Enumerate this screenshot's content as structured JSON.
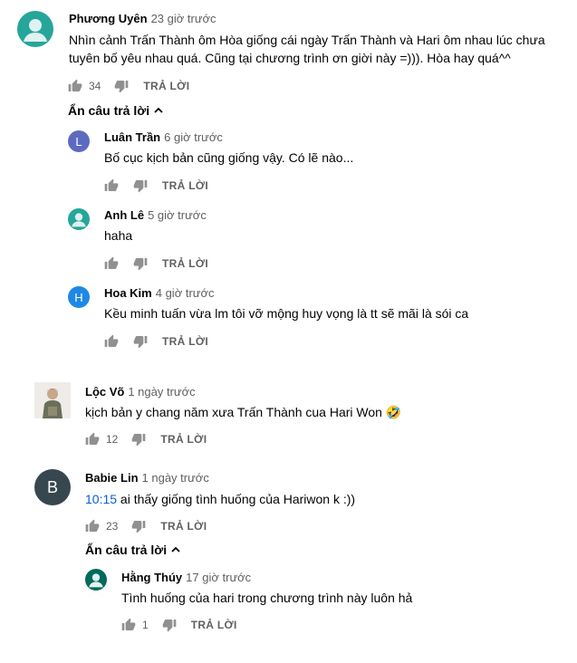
{
  "ui": {
    "reply_label": "TRẢ LỜI",
    "hide_replies_label": "Ẩn câu trả lời"
  },
  "colors": {
    "link": "#065fd4",
    "meta": "#606060",
    "text": "#030303",
    "avatar_teal": "#26a69a",
    "avatar_purple": "#5c6bc0",
    "avatar_blue": "#1e88e5",
    "avatar_slate": "#37474f",
    "avatar_green": "#00695c"
  },
  "comments": [
    {
      "author": "Phương Uyên",
      "time": "23 giờ trước",
      "lines": [
        "Nhìn cảnh Trấn Thành ôm Hòa giống cái ngày Trấn Thành và Hari ôm nhau lúc chưa",
        "tuyên bố yêu nhau quá. Cũng tại chương trình ơn giời này =))). Hòa hay quá^^"
      ],
      "likes": "34",
      "avatar_icon": "default-person-icon",
      "replies": [
        {
          "author": "Luân Trần",
          "time": "6 giờ trước",
          "text": "Bố cục kịch bản cũng giống vậy. Có lẽ nào...",
          "initial": "L"
        },
        {
          "author": "Anh Lê",
          "time": "5 giờ trước",
          "text": "haha",
          "avatar_icon": "default-person-icon"
        },
        {
          "author": "Hoa Kim",
          "time": "4 giờ trước",
          "text": "Kều minh tuấn vừa lm tôi vỡ mộng huy vọng là tt sẽ mãi là sói ca",
          "initial": "H"
        }
      ]
    },
    {
      "author": "Lộc Võ",
      "time": "1 ngày trước",
      "text": "kịch bản y chang năm xưa Trấn Thành cua Hari Won 🤣",
      "likes": "12",
      "avatar_icon": "photo-avatar-icon"
    },
    {
      "author": "Babie Lin",
      "time": "1 ngày trước",
      "timestamp_link": "10:15",
      "text": " ai thấy giống tình huống của Hariwon k :))",
      "likes": "23",
      "initial": "B",
      "replies": [
        {
          "author": "Hằng Thúy",
          "time": "17 giờ trước",
          "text": "Tình huống của hari trong chương trình này luôn hả",
          "likes": "1",
          "avatar_icon": "default-person-icon"
        }
      ]
    }
  ]
}
